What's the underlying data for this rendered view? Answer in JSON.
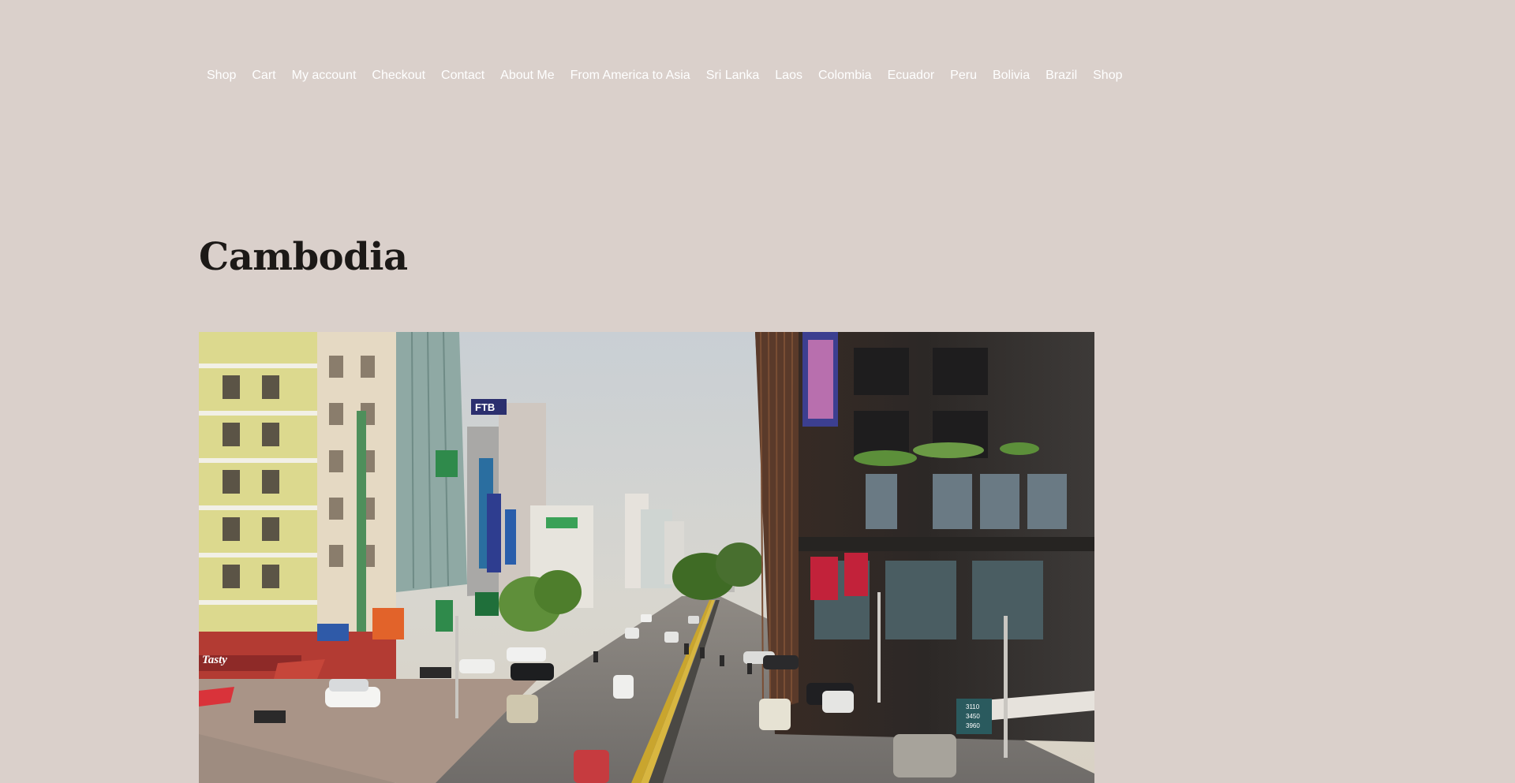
{
  "nav": {
    "items": [
      {
        "label": "Shop"
      },
      {
        "label": "Cart"
      },
      {
        "label": "My account"
      },
      {
        "label": "Checkout"
      },
      {
        "label": "Contact"
      },
      {
        "label": "About Me"
      },
      {
        "label": "From America to Asia"
      },
      {
        "label": "Sri Lanka"
      },
      {
        "label": "Laos"
      },
      {
        "label": "Colombia"
      },
      {
        "label": "Ecuador"
      },
      {
        "label": "Peru"
      },
      {
        "label": "Bolivia"
      },
      {
        "label": "Brazil"
      },
      {
        "label": "Shop"
      }
    ]
  },
  "page": {
    "title": "Cambodia"
  },
  "hero_image": {
    "signs": {
      "ftb": "FTB",
      "tasty": "Tasty",
      "rates": [
        "3110",
        "3450",
        "3960"
      ]
    }
  },
  "colors": {
    "background": "#dad0cb",
    "nav_text": "#ffffff",
    "title_text": "#1c1917"
  }
}
